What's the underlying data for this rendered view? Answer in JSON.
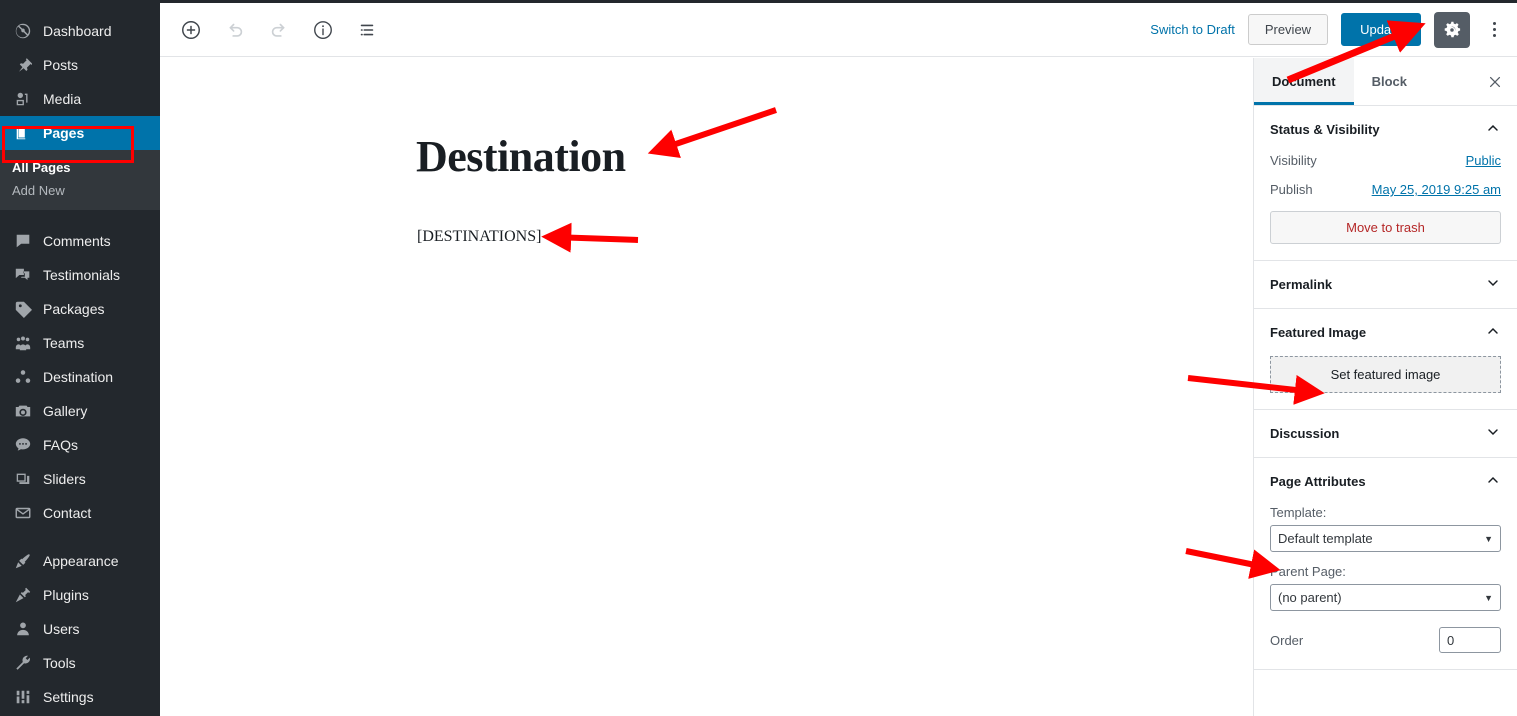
{
  "admin_sidebar": {
    "items": [
      {
        "label": "Dashboard",
        "icon": "dashboard-icon",
        "current": false
      },
      {
        "label": "Posts",
        "icon": "pin-icon",
        "current": false
      },
      {
        "label": "Media",
        "icon": "media-icon",
        "current": false
      },
      {
        "label": "Pages",
        "icon": "pages-icon",
        "current": true
      },
      {
        "label": "Comments",
        "icon": "comment-icon",
        "current": false
      },
      {
        "label": "Testimonials",
        "icon": "testimonials-icon",
        "current": false
      },
      {
        "label": "Packages",
        "icon": "tag-icon",
        "current": false
      },
      {
        "label": "Teams",
        "icon": "teams-icon",
        "current": false
      },
      {
        "label": "Destination",
        "icon": "destination-icon",
        "current": false
      },
      {
        "label": "Gallery",
        "icon": "camera-icon",
        "current": false
      },
      {
        "label": "FAQs",
        "icon": "faq-icon",
        "current": false
      },
      {
        "label": "Sliders",
        "icon": "sliders-icon",
        "current": false
      },
      {
        "label": "Contact",
        "icon": "envelope-icon",
        "current": false
      },
      {
        "label": "Appearance",
        "icon": "brush-icon",
        "current": false
      },
      {
        "label": "Plugins",
        "icon": "plugin-icon",
        "current": false
      },
      {
        "label": "Users",
        "icon": "user-icon",
        "current": false
      },
      {
        "label": "Tools",
        "icon": "wrench-icon",
        "current": false
      },
      {
        "label": "Settings",
        "icon": "settings-sliders-icon",
        "current": false
      }
    ],
    "submenu": {
      "all_pages": "All Pages",
      "add_new": "Add New"
    }
  },
  "header": {
    "icons": {
      "add_block": "plus-circle-icon",
      "undo": "undo-icon",
      "redo": "redo-icon",
      "info": "info-circle-icon",
      "block_navigation": "list-view-icon"
    },
    "switch_to_draft": "Switch to Draft",
    "preview": "Preview",
    "update": "Update",
    "settings_gear": "gear-icon",
    "more_menu": "kebab-menu-icon"
  },
  "editor": {
    "title": "Destination",
    "body": "[DESTINATIONS]"
  },
  "settings": {
    "tabs": [
      {
        "label": "Document",
        "active": true
      },
      {
        "label": "Block",
        "active": false
      }
    ],
    "close": "close-icon",
    "panels": {
      "status_visibility": {
        "title": "Status & Visibility",
        "expanded": true,
        "visibility_label": "Visibility",
        "visibility_value": "Public",
        "publish_label": "Publish",
        "publish_value": "May 25, 2019 9:25 am",
        "move_to_trash": "Move to trash"
      },
      "permalink": {
        "title": "Permalink",
        "expanded": false
      },
      "featured_image": {
        "title": "Featured Image",
        "expanded": true,
        "set_button": "Set featured image"
      },
      "discussion": {
        "title": "Discussion",
        "expanded": false
      },
      "page_attributes": {
        "title": "Page Attributes",
        "expanded": true,
        "template_label": "Template:",
        "template_value": "Default template",
        "parent_label": "Parent Page:",
        "parent_value": "(no parent)",
        "order_label": "Order",
        "order_value": "0"
      }
    }
  },
  "colors": {
    "admin_bg": "#23282d",
    "admin_submenu_bg": "#32373c",
    "accent_blue": "#0073aa",
    "annotation_red": "#ff0000",
    "trash_red": "#b52727"
  },
  "annotations": {
    "highlight_target": "Pages",
    "arrows": [
      {
        "name": "arrow-to-update-button",
        "target": "Update"
      },
      {
        "name": "arrow-to-post-title",
        "target": "Destination"
      },
      {
        "name": "arrow-to-shortcode",
        "target": "[DESTINATIONS]"
      },
      {
        "name": "arrow-to-set-featured-image",
        "target": "Set featured image"
      },
      {
        "name": "arrow-to-template-select",
        "target": "Default template"
      }
    ]
  }
}
